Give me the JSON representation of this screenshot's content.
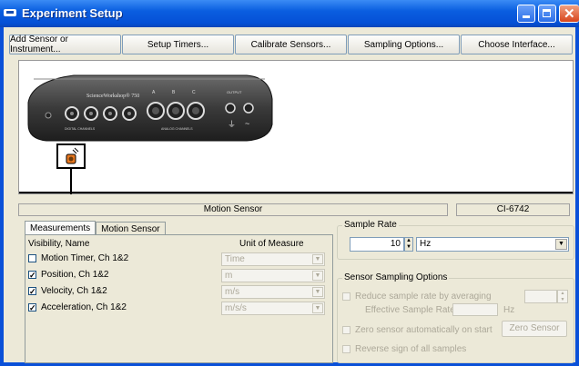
{
  "window": {
    "title": "Experiment Setup"
  },
  "toolbar": [
    "Add Sensor or Instrument...",
    "Setup Timers...",
    "Calibrate Sensors...",
    "Sampling Options...",
    "Choose Interface..."
  ],
  "device": {
    "brand": "ScienceWorkshop® 750",
    "label_digital": "DIGITAL CHANNELS",
    "label_analog": "ANALOG CHANNELS",
    "digital_ports": [
      "1",
      "2",
      "3",
      "4"
    ],
    "analog_ports": [
      "A",
      "B",
      "C"
    ],
    "label_output": "OUTPUT"
  },
  "status": {
    "sensor_name": "Motion Sensor",
    "sensor_id": "CI-6742"
  },
  "tabs": [
    "Measurements",
    "Motion Sensor"
  ],
  "measurements": {
    "col_visibility": "Visibility, Name",
    "col_unit": "Unit of Measure",
    "rows": [
      {
        "checked": false,
        "name": "Motion Timer, Ch 1&2",
        "unit": "Time"
      },
      {
        "checked": true,
        "name": "Position, Ch 1&2",
        "unit": "m"
      },
      {
        "checked": true,
        "name": "Velocity, Ch 1&2",
        "unit": "m/s"
      },
      {
        "checked": true,
        "name": "Acceleration, Ch 1&2",
        "unit": "m/s/s"
      }
    ]
  },
  "sample_rate": {
    "title": "Sample Rate",
    "value": "10",
    "unit": "Hz"
  },
  "sensor_options": {
    "title": "Sensor Sampling Options",
    "reduce_label": "Reduce sample rate by averaging",
    "effective_label": "Effective Sample Rate",
    "effective_unit": "Hz",
    "zero_label": "Zero sensor automatically on start",
    "zero_button": "Zero Sensor",
    "reverse_label": "Reverse sign of all samples"
  },
  "colors": {
    "titlebar": "#0a5ee0",
    "window_bg": "#ece9d8",
    "accent_orange": "#e87820"
  }
}
